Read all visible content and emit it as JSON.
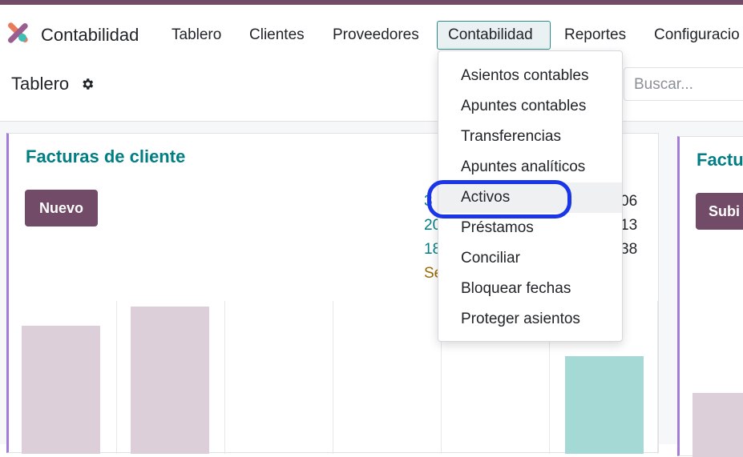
{
  "navbar": {
    "app_title": "Contabilidad",
    "items": [
      {
        "label": "Tablero"
      },
      {
        "label": "Clientes"
      },
      {
        "label": "Proveedores"
      },
      {
        "label": "Contabilidad"
      },
      {
        "label": "Reportes"
      },
      {
        "label": "Configuracio"
      }
    ],
    "active_item": "Contabilidad",
    "logo_icon": "odoo-accounting-logo-icon"
  },
  "control_panel": {
    "title": "Tablero",
    "settings_icon": "gear-icon",
    "search_placeholder": "Buscar..."
  },
  "dropdown": {
    "items": [
      {
        "label": "Asientos contables"
      },
      {
        "label": "Apuntes contables"
      },
      {
        "label": "Transferencias"
      },
      {
        "label": "Apuntes analíticos"
      },
      {
        "label": "Activos"
      },
      {
        "label": "Préstamos"
      },
      {
        "label": "Conciliar"
      },
      {
        "label": "Bloquear fechas"
      },
      {
        "label": "Proteger asientos"
      }
    ],
    "highlighted_item": "Activos"
  },
  "cards": {
    "customer_invoices": {
      "title": "Facturas de cliente",
      "new_button": "Nuevo",
      "stats_left": [
        "3",
        "20",
        "18",
        "Se"
      ],
      "stats_right": [
        "06",
        "13",
        "38"
      ]
    },
    "vendor_bills": {
      "title": "Factu",
      "upload_button": "Subi"
    }
  },
  "colors": {
    "brand": "#714b67",
    "accent_teal": "#017e84",
    "bar_past": "#dccfd9",
    "bar_future": "#a5d9d6",
    "highlight_ring": "#1a36e8",
    "card_border": "#a37bd8"
  }
}
